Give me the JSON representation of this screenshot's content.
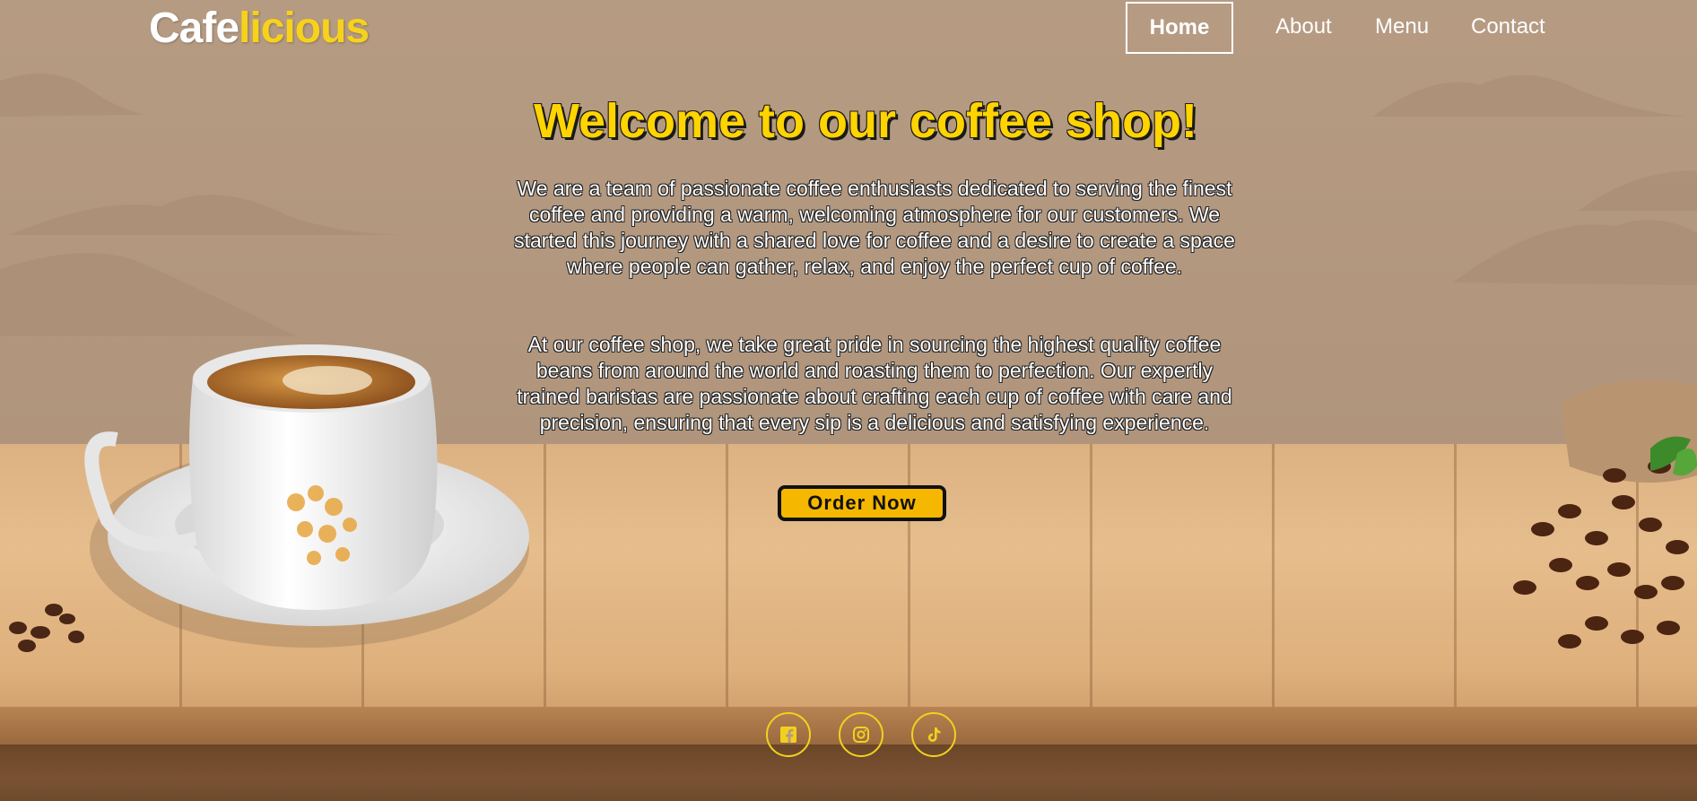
{
  "brand": {
    "name_part1": "Cafe",
    "name_part2": "licious",
    "accent_color": "#f7d21b"
  },
  "nav": {
    "items": [
      {
        "label": "Home",
        "active": true
      },
      {
        "label": "About",
        "active": false
      },
      {
        "label": "Menu",
        "active": false
      },
      {
        "label": "Contact",
        "active": false
      }
    ]
  },
  "hero": {
    "title": "Welcome to our coffee shop!",
    "paragraph1": "We are a team of passionate coffee enthusiasts dedicated to serving the finest coffee and providing a warm, welcoming atmosphere for our customers. We started this journey with a shared love for coffee and a desire to create a space where people can gather, relax, and enjoy the perfect cup of coffee.",
    "paragraph2": "At our coffee shop, we take great pride in sourcing the highest quality coffee beans from around the world and roasting them to perfection. Our expertly trained baristas are passionate about crafting each cup of coffee with care and precision, ensuring that every sip is a delicious and satisfying experience.",
    "cta_label": "Order Now"
  },
  "social": {
    "icons": [
      "facebook-icon",
      "instagram-icon",
      "tiktok-icon"
    ],
    "color": "#f2d11e"
  }
}
